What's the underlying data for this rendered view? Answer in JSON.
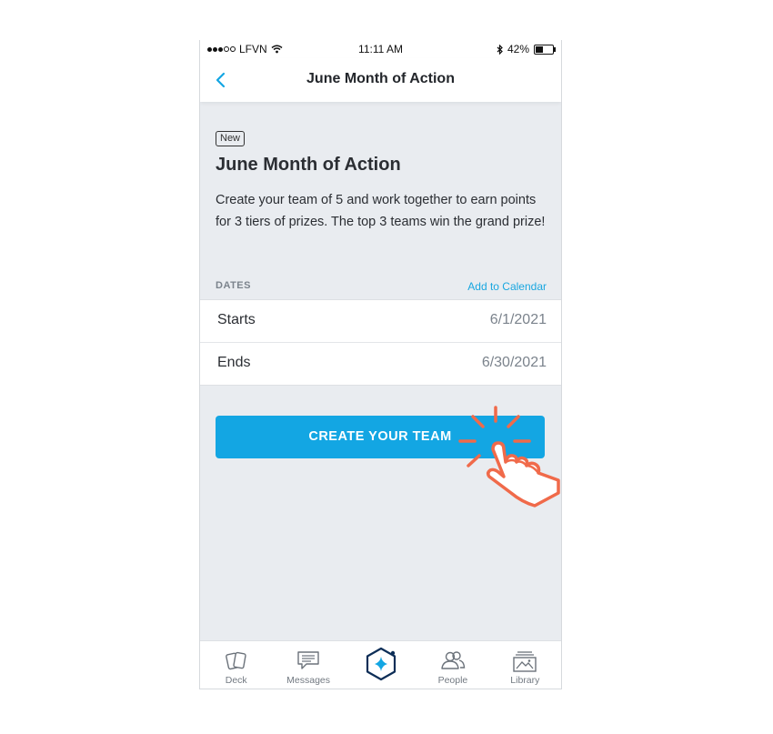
{
  "status_bar": {
    "carrier": "LFVN",
    "time": "11:11 AM",
    "battery_percent": "42%",
    "battery_level": 0.42
  },
  "nav": {
    "title": "June Month of Action",
    "back_icon": "chevron-left-icon"
  },
  "event": {
    "badge": "New",
    "title": "June Month of Action",
    "description": "Create your team of 5 and work together to earn points for 3 tiers of prizes. The top 3 teams win the grand prize!"
  },
  "dates": {
    "section_label": "DATES",
    "add_calendar": "Add to Calendar",
    "rows": [
      {
        "label": "Starts",
        "value": "6/1/2021"
      },
      {
        "label": "Ends",
        "value": "6/30/2021"
      }
    ]
  },
  "cta": {
    "label": "CREATE YOUR TEAM"
  },
  "tabbar": {
    "tabs": [
      {
        "label": "Deck",
        "icon": "cards-icon"
      },
      {
        "label": "Messages",
        "icon": "message-icon"
      },
      {
        "label": "",
        "icon": "hexagon-star-icon"
      },
      {
        "label": "People",
        "icon": "people-icon"
      },
      {
        "label": "Library",
        "icon": "library-icon"
      }
    ]
  },
  "colors": {
    "accent": "#13a6e3",
    "link": "#1aa7e0",
    "hand_overlay": "#f06a4a",
    "background": "#e9ecf0",
    "center_tab": "#0d2e57"
  }
}
